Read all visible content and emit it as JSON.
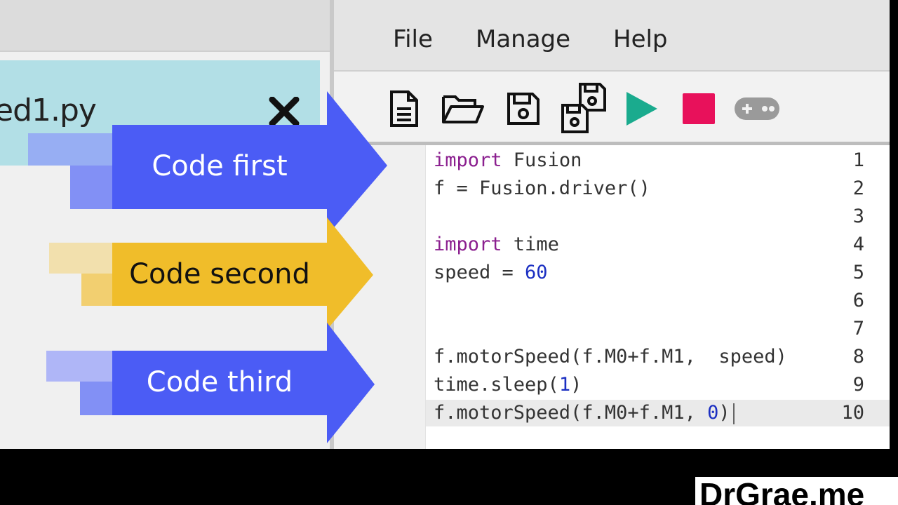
{
  "file_tab": {
    "name": "ed1.py"
  },
  "menu": {
    "items": [
      "File",
      "Manage",
      "Help"
    ]
  },
  "toolbar": {
    "buttons": [
      {
        "icon": "new-file-icon"
      },
      {
        "icon": "open-folder-icon"
      },
      {
        "icon": "save-icon"
      },
      {
        "icon": "save-all-icon"
      },
      {
        "icon": "run-icon",
        "color": "#1aab8e"
      },
      {
        "icon": "stop-icon",
        "color": "#e8115b"
      },
      {
        "icon": "gamepad-icon"
      }
    ]
  },
  "editor": {
    "line_numbers": [
      "1",
      "2",
      "3",
      "4",
      "5",
      "6",
      "7",
      "8",
      "9",
      "10"
    ],
    "lines": [
      {
        "kw": "import",
        "rest": " Fusion"
      },
      {
        "text": "f = Fusion.driver()"
      },
      {
        "text": ""
      },
      {
        "kw": "import",
        "rest": " time"
      },
      {
        "pre": "speed = ",
        "num": "60"
      },
      {
        "text": ""
      },
      {
        "text": ""
      },
      {
        "text": "f.motorSpeed(f.M0+f.M1,  speed)"
      },
      {
        "pre": "time.sleep(",
        "num": "1",
        "post": ")"
      },
      {
        "pre": "f.motorSpeed(f.M0+f.M1, ",
        "num": "0",
        "post": ")"
      }
    ]
  },
  "callouts": [
    {
      "label": "Code first",
      "color": "#4b5cf5"
    },
    {
      "label": "Code second",
      "color": "#f0bd2a"
    },
    {
      "label": "Code third",
      "color": "#4b5cf5"
    }
  ],
  "watermark": {
    "text": "DrGrae.me"
  },
  "colors": {
    "keyword": "#8b1f8f",
    "number": "#1b2fc2",
    "tab": "#b2dfe6"
  }
}
